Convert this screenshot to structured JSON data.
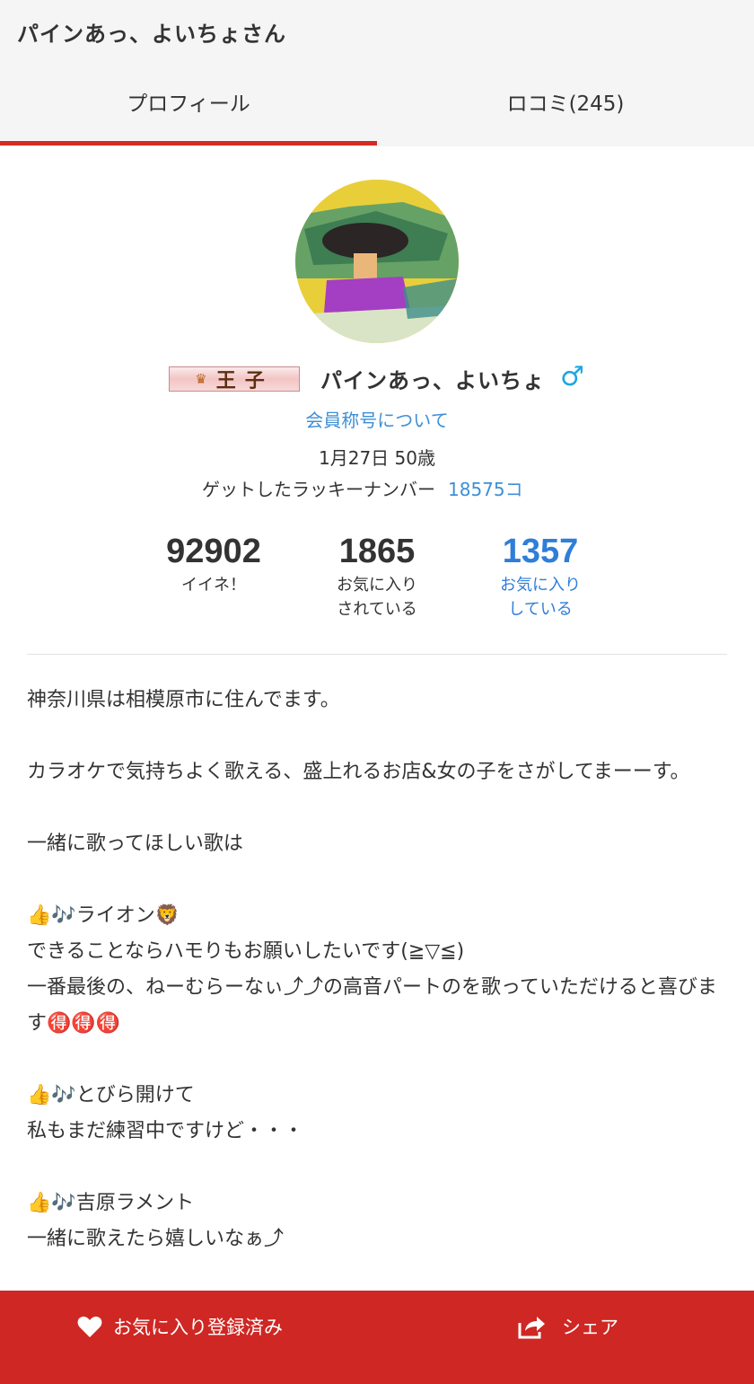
{
  "header": {
    "title": "パインあっ、よいちょさん",
    "tabs": [
      {
        "label": "プロフィール",
        "active": true
      },
      {
        "label": "ロコミ(245)",
        "active": false
      }
    ]
  },
  "profile": {
    "badge": "王子",
    "name": "パインあっ、よいちょ",
    "gender_symbol": "♂",
    "title_link": "会員称号について",
    "birthday": "1月27日 50歳",
    "lucky_label": "ゲットしたラッキーナンバー",
    "lucky_value": "18575コ"
  },
  "stats": [
    {
      "value": "92902",
      "label": "イイネ！"
    },
    {
      "value": "1865",
      "label": "お気に入り\nされている"
    },
    {
      "value": "1357",
      "label": "お気に入り\nしている"
    }
  ],
  "bio": [
    "神奈川県は相模原市に住んでます。",
    "",
    "カラオケで気持ちよく歌える、盛上れるお店&女の子をさがしてまーーす。",
    "",
    "一緒に歌ってほしい歌は",
    "",
    "👍🎶ライオン🦁",
    "できることならハモりもお願いしたいです(≧▽≦)",
    "一番最後の、ねーむらーなぃ⤴⤴の高音パートのを歌っていただけると喜びます🉐🉐🉐",
    "",
    "👍🎶とびら開けて",
    "私もまだ練習中ですけど・・・",
    "",
    "👍🎶吉原ラメント",
    "一緒に歌えたら嬉しいなぁ⤴"
  ],
  "bottom_bar": {
    "favorite_label": "お気に入り登録済み",
    "share_label": "シェア"
  },
  "colors": {
    "accent_red": "#cf2723",
    "link_blue": "#3e8fd6",
    "stat_blue": "#2f7ed8",
    "male_blue": "#1ea7e1"
  }
}
